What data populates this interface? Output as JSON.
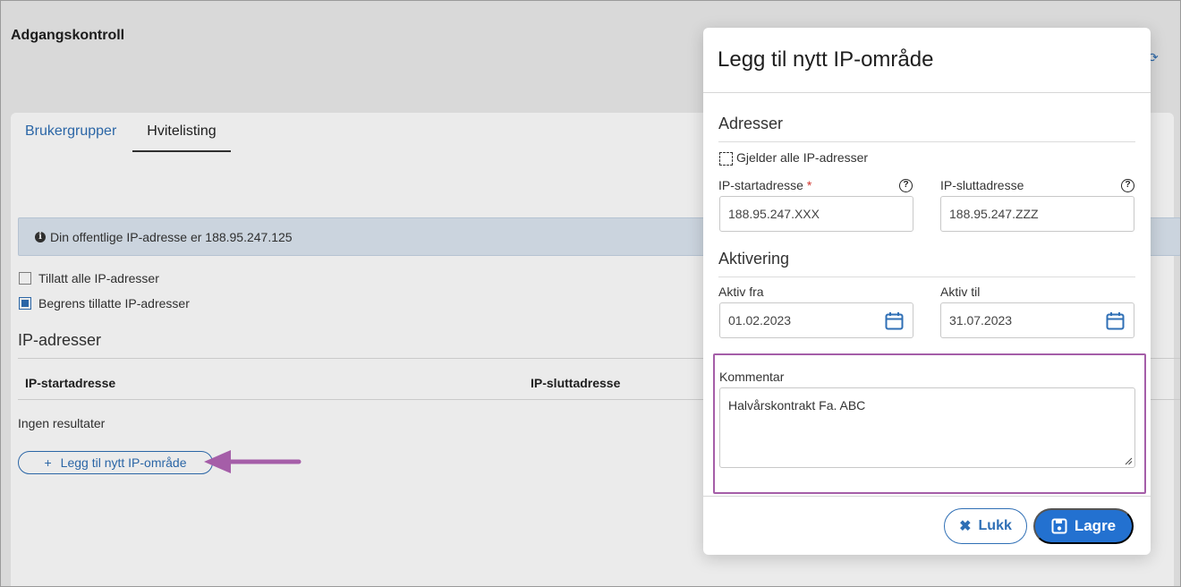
{
  "page": {
    "title": "Adgangskontroll",
    "tabs": [
      {
        "label": "Brukergrupper",
        "active": false
      },
      {
        "label": "Hvitelisting",
        "active": true
      }
    ],
    "info_text": "Din offentlige IP-adresse er 188.95.247.125",
    "options": [
      {
        "label": "Tillatt alle IP-adresser",
        "checked": false
      },
      {
        "label": "Begrens tillatte IP-adresser",
        "checked": true
      }
    ],
    "section_heading": "IP-adresser",
    "columns": [
      "IP-startadresse",
      "IP-sluttadresse"
    ],
    "empty_text": "Ingen resultater",
    "add_button_label": "Legg til nytt IP-område",
    "add_button_icon": "+"
  },
  "modal": {
    "title": "Legg til nytt IP-område",
    "section_addresses": "Adresser",
    "all_ips_label": "Gjelder alle IP-adresser",
    "start_label": "IP-startadresse",
    "required_marker": "*",
    "start_value": "188.95.247.XXX",
    "end_label": "IP-sluttadresse",
    "end_value": "188.95.247.ZZZ",
    "section_activation": "Aktivering",
    "from_label": "Aktiv fra",
    "from_value": "01.02.2023",
    "to_label": "Aktiv til",
    "to_value": "31.07.2023",
    "comment_label": "Kommentar",
    "comment_value": "Halvårskontrakt Fa. ABC",
    "close_label": "Lukk",
    "save_label": "Lagre",
    "help_glyph": "?"
  },
  "colors": {
    "accent": "#2f6fb5",
    "primary_button": "#2371d0",
    "highlight": "#a55ea8",
    "required": "#d0342c"
  }
}
